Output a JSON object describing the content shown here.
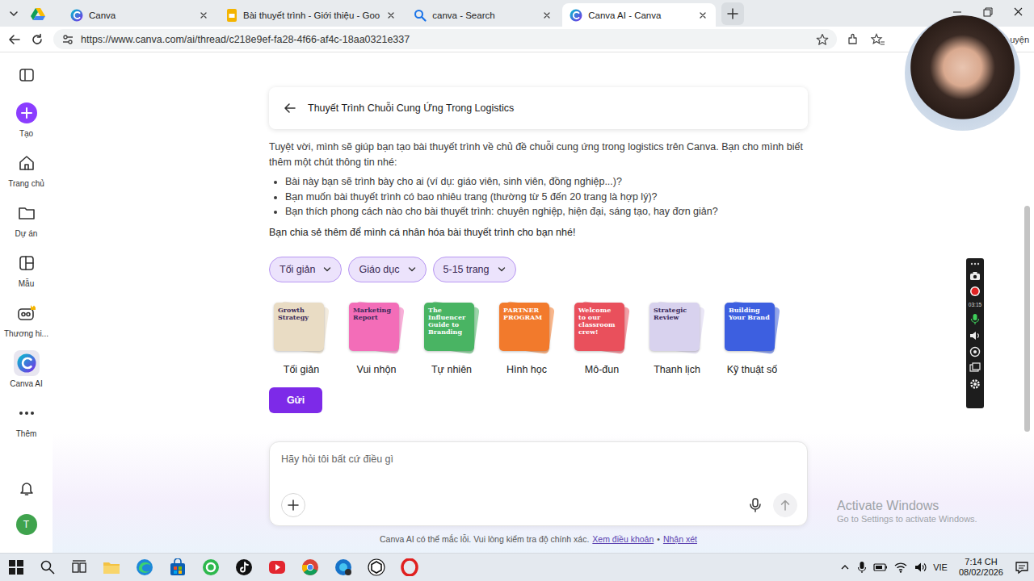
{
  "browser": {
    "tabs": [
      {
        "label": "Canva",
        "kind": "canva",
        "selected": false
      },
      {
        "label": "Bài thuyết trình - Giới thiệu - Goo",
        "kind": "slides",
        "selected": false
      },
      {
        "label": "canva - Search",
        "kind": "search",
        "selected": false
      },
      {
        "label": "Canva AI - Canva",
        "kind": "canva",
        "selected": true
      }
    ],
    "url": "https://www.canva.com/ai/thread/c218e9ef-fa28-4f66-af4c-18aa0321e337",
    "profile_label": "uyện"
  },
  "sidebar": {
    "items": [
      {
        "label": "Tạo",
        "kind": "create",
        "selected": false
      },
      {
        "label": "Trang chủ",
        "kind": "home",
        "selected": false
      },
      {
        "label": "Dự án",
        "kind": "folder",
        "selected": false
      },
      {
        "label": "Mẫu",
        "kind": "template",
        "selected": false
      },
      {
        "label": "Thương hi...",
        "kind": "brand",
        "selected": false
      },
      {
        "label": "Canva AI",
        "kind": "ai",
        "selected": true
      },
      {
        "label": "Thêm",
        "kind": "more",
        "selected": false
      }
    ],
    "avatar": "T"
  },
  "thread": {
    "title": "Thuyết Trình Chuỗi Cung Ứng Trong Logistics"
  },
  "message": {
    "intro": "Tuyệt vời, mình sẽ giúp bạn tạo bài thuyết trình về chủ đề chuỗi cung ứng trong logistics trên Canva. Bạn cho mình biết thêm một chút thông tin nhé:",
    "bullets": [
      "Bài này bạn sẽ trình bày cho ai (ví dụ: giáo viên, sinh viên, đồng nghiệp...)?",
      "Bạn muốn bài thuyết trình có bao nhiêu trang (thường từ 5 đến 20 trang là hợp lý)?",
      "Bạn thích phong cách nào cho bài thuyết trình: chuyên nghiệp, hiện đại, sáng tạo, hay đơn giản?"
    ],
    "outro": "Bạn chia sẻ thêm để mình cá nhân hóa bài thuyết trình cho bạn nhé!"
  },
  "chips": [
    {
      "label": "Tối giản"
    },
    {
      "label": "Giáo dục"
    },
    {
      "label": "5-15 trang"
    }
  ],
  "styles": [
    {
      "label": "Tối giản",
      "thumb": "Growth Strategy",
      "color": "#e9dcc4"
    },
    {
      "label": "Vui nhộn",
      "thumb": "Marketing Report",
      "color": "#f36db8"
    },
    {
      "label": "Tự nhiên",
      "thumb": "The Influencer Guide to Branding",
      "color": "#49b463"
    },
    {
      "label": "Hình học",
      "thumb": "PARTNER PROGRAM",
      "color": "#f27a2c"
    },
    {
      "label": "Mô-đun",
      "thumb": "Welcome to our classroom crew!",
      "color": "#e9505c"
    },
    {
      "label": "Thanh lịch",
      "thumb": "Strategic Review",
      "color": "#d8d2ee"
    },
    {
      "label": "Kỹ thuật số",
      "thumb": "Building Your Brand",
      "color": "#3d5fe0"
    }
  ],
  "send_button": "Gửi",
  "composer": {
    "placeholder": "Hãy hỏi tôi bất cứ điều gì"
  },
  "footer": {
    "note": "Canva AI có thể mắc lỗi. Vui lòng kiểm tra độ chính xác.",
    "terms": "Xem điều khoản",
    "sep": "•",
    "feedback": "Nhận xét"
  },
  "recorder": {
    "time": "03:15"
  },
  "watermark": {
    "title": "Activate Windows",
    "subtitle": "Go to Settings to activate Windows."
  },
  "taskbar": {
    "language": "VIE",
    "time": "7:14 CH",
    "date": "08/02/2026"
  }
}
